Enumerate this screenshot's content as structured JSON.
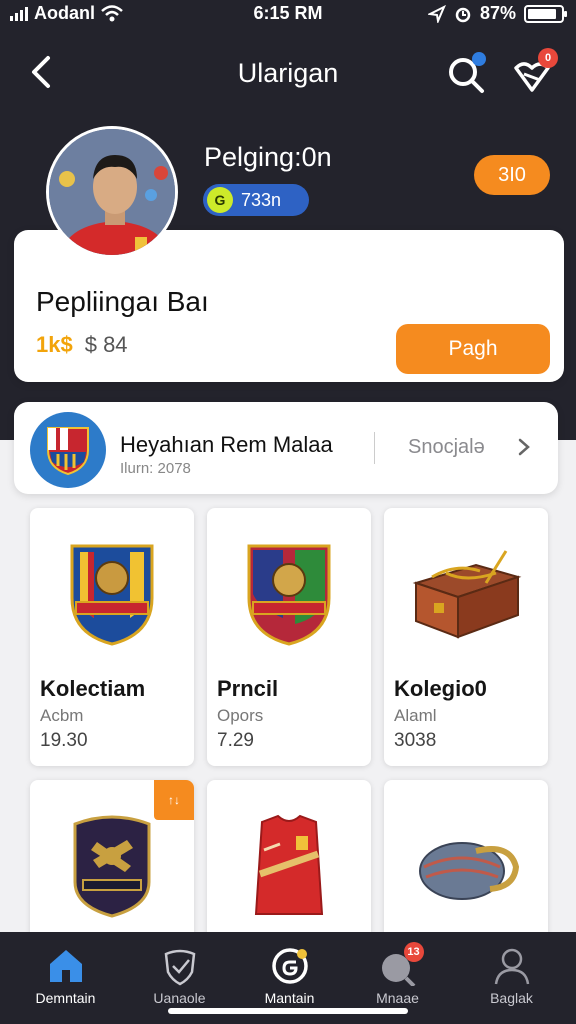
{
  "status_bar": {
    "carrier": "Aodanl",
    "time": "6:15 RM",
    "battery": "87%",
    "battery_level": 0.87
  },
  "nav": {
    "title": "Ularigan",
    "back_icon": "chevron-left-icon",
    "search_icon": "search-icon",
    "notify_icon": "heart-bell-icon",
    "notify_badge": "0"
  },
  "profile": {
    "name": "Pelging:0n",
    "xp_value": "733n",
    "xp_coin": "G",
    "level_badge": "3I0"
  },
  "balance_card": {
    "title": "Pepliingaı Baı",
    "amount_accent": "1k$",
    "amount_value": "$ 84",
    "pay_label": "Pagh"
  },
  "club": {
    "name": "Heyahıan Rem Malaa",
    "subtitle": "Ilurn: 2078",
    "link_label": "Snocjalə"
  },
  "items": [
    {
      "title": "Kolectiam",
      "subtitle": "Acbm",
      "price": "19.30",
      "image": "club-crest-yellow"
    },
    {
      "title": "Prncil",
      "subtitle": "Opors",
      "price": "7.29",
      "image": "club-crest-green"
    },
    {
      "title": "Kolegio0",
      "subtitle": "Alaml",
      "price": "3038",
      "image": "treasure-chest"
    },
    {
      "title": "",
      "subtitle": "",
      "price": "",
      "image": "dark-shield",
      "tag": "↑↓"
    },
    {
      "title": "",
      "subtitle": "",
      "price": "",
      "image": "red-jersey"
    },
    {
      "title": "",
      "subtitle": "",
      "price": "",
      "image": "knit-cap"
    }
  ],
  "bottom_nav": [
    {
      "label": "Demntain",
      "icon": "home-icon",
      "active": true
    },
    {
      "label": "Uanaole",
      "icon": "shield-icon",
      "active": false
    },
    {
      "label": "Mantain",
      "icon": "search-g-icon",
      "active": false
    },
    {
      "label": "Mnaae",
      "icon": "ball-icon",
      "badge": "13",
      "active": false
    },
    {
      "label": "Baglak",
      "icon": "person-icon",
      "active": false
    }
  ],
  "colors": {
    "header_bg": "#23232c",
    "accent_orange": "#f58b1f",
    "xp_blue": "#2e62c4",
    "badge_red": "#e8483b"
  }
}
